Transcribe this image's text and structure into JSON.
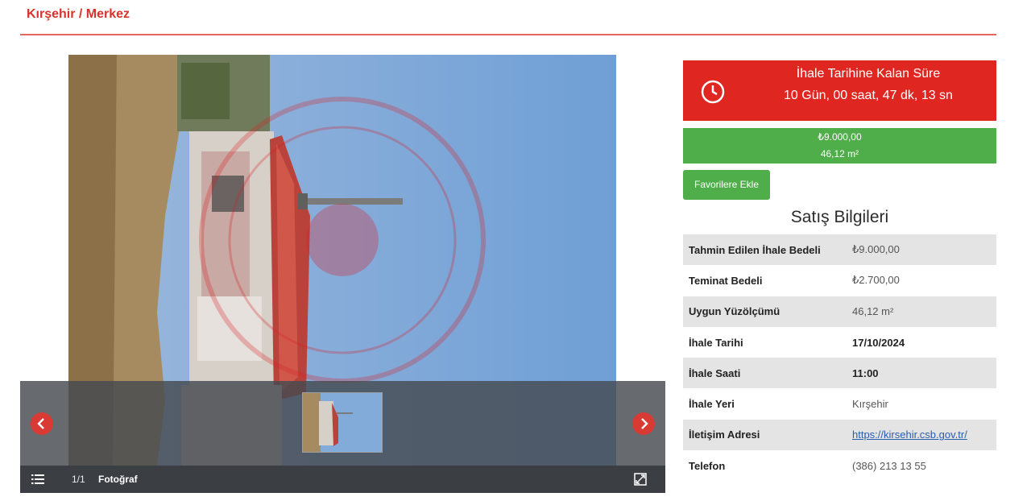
{
  "header": {
    "breadcrumb": "Kırşehir / Merkez"
  },
  "gallery": {
    "counter": "1/1",
    "photo_label": "Fotoğraf",
    "icons": {
      "prev": "chevron-left-icon",
      "next": "chevron-right-icon",
      "list": "list-icon",
      "fullscreen": "fullscreen-icon"
    }
  },
  "countdown": {
    "label": "İhale Tarihine Kalan Süre",
    "value": "10 Gün, 00 saat, 47 dk, 13 sn",
    "icon": "clock-icon"
  },
  "summary": {
    "price": "₺9.000,00",
    "area": "46,12 m²"
  },
  "favorite_button": "Favorilere Ekle",
  "section_title": "Satış Bilgileri",
  "info": {
    "rows": [
      {
        "label": "Tahmin Edilen İhale Bedeli",
        "value": "₺9.000,00"
      },
      {
        "label": "Teminat Bedeli",
        "value": "₺2.700,00"
      },
      {
        "label": "Uygun Yüzölçümü",
        "value": "46,12 m²"
      },
      {
        "label": "İhale Tarihi",
        "value": "17/10/2024"
      },
      {
        "label": "İhale Saati",
        "value": "11:00"
      },
      {
        "label": "İhale Yeri",
        "value": "Kırşehir"
      },
      {
        "label": "İletişim Adresi",
        "value": "https://kirsehir.csb.gov.tr/"
      },
      {
        "label": "Telefon",
        "value": "(386) 213 13 55"
      }
    ]
  },
  "colors": {
    "accent_red": "#df2621",
    "success_green": "#4fae49",
    "breadcrumb_red": "#d9322c"
  }
}
